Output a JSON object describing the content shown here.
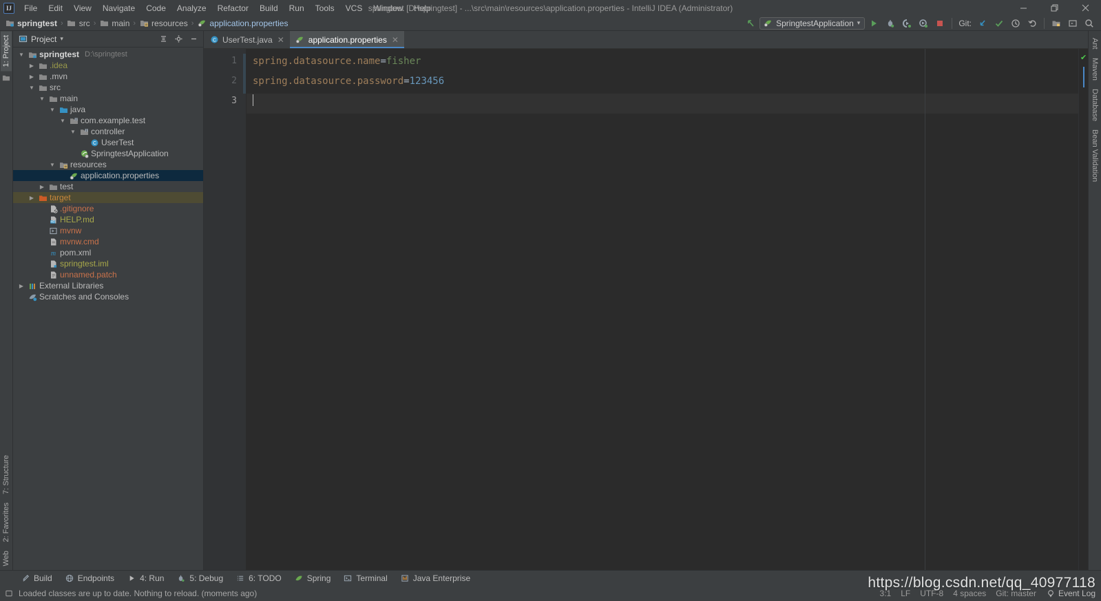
{
  "window": {
    "title": "springtest [D:\\springtest] - ...\\src\\main\\resources\\application.properties - IntelliJ IDEA (Administrator)",
    "logo": "IJ",
    "minimize": "—",
    "restore": "❐",
    "close": "✕"
  },
  "menubar": [
    {
      "label": "File"
    },
    {
      "label": "Edit"
    },
    {
      "label": "View"
    },
    {
      "label": "Navigate"
    },
    {
      "label": "Code"
    },
    {
      "label": "Analyze"
    },
    {
      "label": "Refactor"
    },
    {
      "label": "Build"
    },
    {
      "label": "Run"
    },
    {
      "label": "Tools"
    },
    {
      "label": "VCS"
    },
    {
      "label": "Window"
    },
    {
      "label": "Help"
    }
  ],
  "breadcrumb": [
    {
      "label": "springtest",
      "icon": "module-icon"
    },
    {
      "label": "src",
      "icon": "folder-icon"
    },
    {
      "label": "main",
      "icon": "folder-icon"
    },
    {
      "label": "resources",
      "icon": "resources-folder-icon"
    },
    {
      "label": "application.properties",
      "icon": "properties-file-icon"
    }
  ],
  "breadcrumb_separator": "›",
  "toolbar": {
    "back_arrow": "back-arrow-icon",
    "run_configuration": "SpringtestApplication",
    "dropdown_caret": "▾",
    "buttons": [
      {
        "name": "run-button",
        "glyph": "▶"
      },
      {
        "name": "debug-button",
        "glyph": "⚙"
      },
      {
        "name": "run-coverage-button",
        "glyph": "◐"
      },
      {
        "name": "profile-button",
        "glyph": "◔"
      },
      {
        "name": "stop-button",
        "glyph": "■"
      }
    ],
    "git_label": "Git:",
    "git_buttons": [
      {
        "name": "git-update-project-button",
        "glyph": "↙"
      },
      {
        "name": "git-commit-button",
        "glyph": "✔"
      },
      {
        "name": "git-history-button",
        "glyph": "◴"
      },
      {
        "name": "git-rollback-button",
        "glyph": "↶"
      }
    ],
    "extra_buttons": [
      {
        "name": "project-structure-button",
        "glyph": "▣"
      },
      {
        "name": "settings-button",
        "glyph": "⌕"
      },
      {
        "name": "search-everywhere-icon",
        "glyph": "⚲"
      }
    ]
  },
  "left_rail": {
    "top": [
      {
        "label": "1: Project",
        "selected": true
      }
    ],
    "bottom": [
      {
        "label": "7: Structure"
      },
      {
        "label": "2: Favorites"
      },
      {
        "label": "Web"
      }
    ]
  },
  "right_rail": [
    {
      "label": "Ant"
    },
    {
      "label": "Maven"
    },
    {
      "label": "Database"
    },
    {
      "label": "Bean Validation"
    }
  ],
  "project_panel": {
    "title": "Project",
    "title_caret": "▾",
    "tools": [
      {
        "name": "collapse-all-button",
        "glyph": "≣"
      },
      {
        "name": "settings-gear-icon",
        "glyph": "⚙"
      },
      {
        "name": "hide-panel-button",
        "glyph": "—"
      }
    ],
    "tree": [
      {
        "indent": 0,
        "arrow": "▼",
        "icon": "module-icon",
        "label": "springtest",
        "sublabel": "D:\\springtest",
        "bold": true,
        "color": "#d8d8d8"
      },
      {
        "indent": 1,
        "arrow": "▶",
        "icon": "folder-icon",
        "label": ".idea",
        "color": "#9a9a4a"
      },
      {
        "indent": 1,
        "arrow": "▶",
        "icon": "folder-icon",
        "label": ".mvn",
        "color": "#bbbbbb"
      },
      {
        "indent": 1,
        "arrow": "▼",
        "icon": "folder-icon",
        "label": "src",
        "color": "#bbbbbb"
      },
      {
        "indent": 2,
        "arrow": "▼",
        "icon": "folder-icon",
        "label": "main",
        "color": "#bbbbbb"
      },
      {
        "indent": 3,
        "arrow": "▼",
        "icon": "source-folder-icon",
        "label": "java",
        "color": "#bbbbbb"
      },
      {
        "indent": 4,
        "arrow": "▼",
        "icon": "package-icon",
        "label": "com.example.test",
        "color": "#bbbbbb"
      },
      {
        "indent": 5,
        "arrow": "▼",
        "icon": "package-icon",
        "label": "controller",
        "color": "#bbbbbb"
      },
      {
        "indent": 6,
        "arrow": "",
        "icon": "java-class-icon",
        "label": "UserTest",
        "color": "#bbbbbb"
      },
      {
        "indent": 5,
        "arrow": "",
        "icon": "spring-bean-icon",
        "label": "SpringtestApplication",
        "color": "#bbbbbb"
      },
      {
        "indent": 3,
        "arrow": "▼",
        "icon": "resources-folder-icon",
        "label": "resources",
        "color": "#bbbbbb"
      },
      {
        "indent": 4,
        "arrow": "",
        "icon": "properties-file-icon",
        "label": "application.properties",
        "color": "#bbbbbb",
        "selected": true
      },
      {
        "indent": 2,
        "arrow": "▶",
        "icon": "folder-icon",
        "label": "test",
        "color": "#bbbbbb"
      },
      {
        "indent": 1,
        "arrow": "▶",
        "icon": "excluded-folder-icon",
        "label": "target",
        "color": "#c8873b",
        "highlighted": true
      },
      {
        "indent": 2,
        "arrow": "",
        "icon": "gitignore-file-icon",
        "label": ".gitignore",
        "color": "#c9724b"
      },
      {
        "indent": 2,
        "arrow": "",
        "icon": "markdown-file-icon",
        "label": "HELP.md",
        "color": "#a8a84a"
      },
      {
        "indent": 2,
        "arrow": "",
        "icon": "script-file-icon",
        "label": "mvnw",
        "color": "#c9724b"
      },
      {
        "indent": 2,
        "arrow": "",
        "icon": "cmd-file-icon",
        "label": "mvnw.cmd",
        "color": "#c9724b"
      },
      {
        "indent": 2,
        "arrow": "",
        "icon": "maven-pom-icon",
        "label": "pom.xml",
        "color": "#bbbbbb"
      },
      {
        "indent": 2,
        "arrow": "",
        "icon": "iml-file-icon",
        "label": "springtest.iml",
        "color": "#a8a84a"
      },
      {
        "indent": 2,
        "arrow": "",
        "icon": "patch-file-icon",
        "label": "unnamed.patch",
        "color": "#c9724b"
      },
      {
        "indent": 0,
        "arrow": "▶",
        "icon": "libraries-icon",
        "label": "External Libraries",
        "color": "#bbbbbb"
      },
      {
        "indent": 0,
        "arrow": "",
        "icon": "scratches-icon",
        "label": "Scratches and Consoles",
        "color": "#bbbbbb"
      }
    ]
  },
  "editor": {
    "tabs": [
      {
        "label": "UserTest.java",
        "icon": "java-class-icon",
        "active": false,
        "close": "✕"
      },
      {
        "label": "application.properties",
        "icon": "properties-file-icon",
        "active": true,
        "close": "✕"
      }
    ],
    "line_numbers": [
      "1",
      "2",
      "3"
    ],
    "lines": [
      {
        "key": "spring.datasource.name",
        "eq": "=",
        "value": "fisher",
        "value_type": "string"
      },
      {
        "key": "spring.datasource.password",
        "eq": "=",
        "value": "123456",
        "value_type": "number"
      },
      {
        "key": "",
        "eq": "",
        "value": "",
        "value_type": "caret"
      }
    ],
    "inspection_status": "✔"
  },
  "bottom_tool_windows": [
    {
      "label": "Build",
      "icon": "build-hammer-icon",
      "mnemonic": ""
    },
    {
      "label": "Endpoints",
      "icon": "endpoints-globe-icon",
      "mnemonic": ""
    },
    {
      "label": "4: Run",
      "icon": "run-play-icon",
      "mnemonic": "4"
    },
    {
      "label": "5: Debug",
      "icon": "debug-bug-icon",
      "mnemonic": "5"
    },
    {
      "label": "6: TODO",
      "icon": "todo-list-icon",
      "mnemonic": "6"
    },
    {
      "label": "Spring",
      "icon": "spring-leaf-icon",
      "mnemonic": ""
    },
    {
      "label": "Terminal",
      "icon": "terminal-icon",
      "mnemonic": ""
    },
    {
      "label": "Java Enterprise",
      "icon": "java-enterprise-icon",
      "mnemonic": ""
    }
  ],
  "statusbar": {
    "message": "Loaded classes are up to date. Nothing to reload. (moments ago)",
    "message_icon": "notification-icon",
    "caret_position": "3:1",
    "line_separator": "LF",
    "encoding": "UTF-8",
    "indent": "4 spaces",
    "branch": "Git: master",
    "event_log": "Event Log",
    "event_log_icon": "balloon-icon"
  },
  "watermark": "https://blog.csdn.net/qq_40977118",
  "colors": {
    "panel_bg": "#3c3f41",
    "editor_bg": "#2b2b2b",
    "gutter_bg": "#313335",
    "selection_bg": "#0d293e",
    "highlight_bg": "#4e4b33",
    "tab_active_bg": "#4e5254",
    "tab_underline": "#4a88c7",
    "key_color": "#9e7e5a",
    "string_color": "#6a8759",
    "number_color": "#6897bb",
    "ok_green": "#4ec94e"
  }
}
